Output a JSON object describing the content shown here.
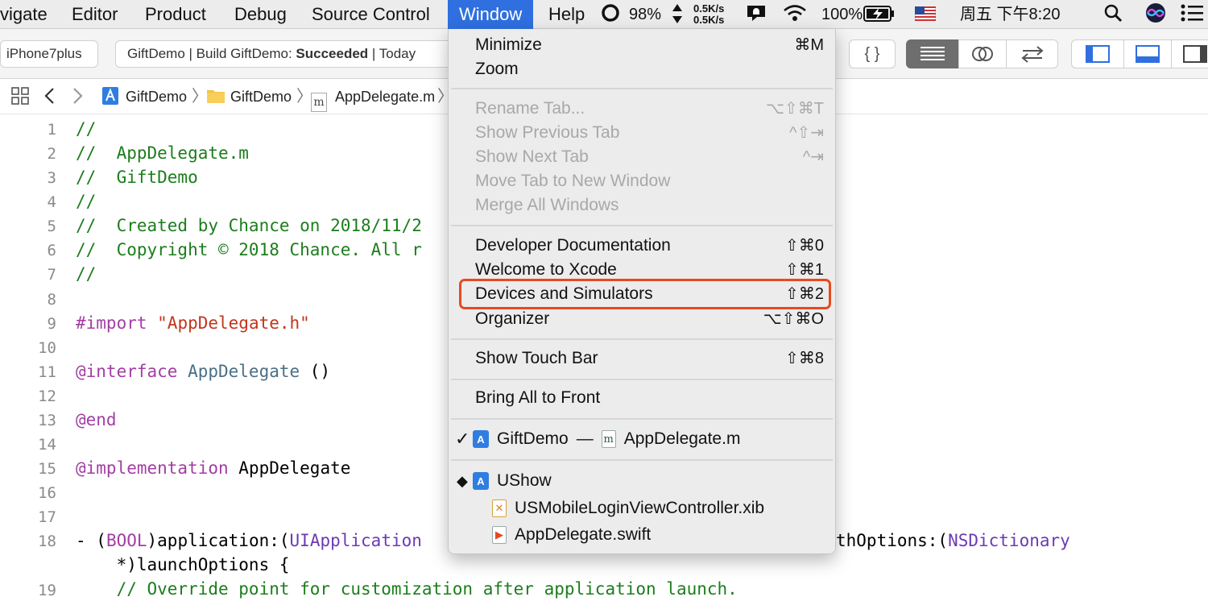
{
  "menubar": {
    "items": [
      "vigate",
      "Editor",
      "Product",
      "Debug",
      "Source Control",
      "Window",
      "Help"
    ],
    "battery_percent": "98%",
    "net_up": "0.5K/s",
    "net_down": "0.5K/s",
    "wifi_battery": "100%",
    "clock": "周五 下午8:20",
    "accent_color": "#2f6fe0"
  },
  "toolbar": {
    "device": "iPhone7plus",
    "status_prefix": "GiftDemo | Build GiftDemo: ",
    "status_result": "Succeeded",
    "status_suffix": " | Today"
  },
  "jumpbar": {
    "crumb1": "GiftDemo",
    "crumb2": "GiftDemo",
    "crumb3": "AppDelegate.m",
    "file_badge": "m"
  },
  "editor": {
    "line_numbers": [
      "1",
      "2",
      "3",
      "4",
      "5",
      "6",
      "7",
      "8",
      "9",
      "10",
      "11",
      "12",
      "13",
      "14",
      "15",
      "16",
      "17",
      "18",
      "",
      "19"
    ],
    "l1": "//",
    "l2": "//  AppDelegate.m",
    "l3": "//  GiftDemo",
    "l4": "//",
    "l5": "//  Created by Chance on 2018/11/2",
    "l6": "//  Copyright © 2018 Chance. All r",
    "l7": "//",
    "l9_kw": "#import ",
    "l9_str": "\"AppDelegate.h\"",
    "l11_kw": "@interface ",
    "l11_type": "AppDelegate",
    "l11_rest": " ()",
    "l13_kw": "@end",
    "l15_kw": "@implementation ",
    "l15_rest": "AppDelegate",
    "l18_a": "- (",
    "l18_bool": "BOOL",
    "l18_b": ")application:(",
    "l18_cls": "UIApplication",
    "l18_right": "thOptions:(",
    "l18_dict": "NSDictionary",
    "l18_cont": "    *)launchOptions {",
    "l19": "    // Override point for customization after application launch."
  },
  "window_menu": {
    "minimize": "Minimize",
    "minimize_sc": "⌘M",
    "zoom": "Zoom",
    "rename_tab": "Rename Tab...",
    "rename_tab_sc": "⌥⇧⌘T",
    "show_prev_tab": "Show Previous Tab",
    "show_prev_tab_sc": "^⇧⇥",
    "show_next_tab": "Show Next Tab",
    "show_next_tab_sc": "^⇥",
    "move_tab": "Move Tab to New Window",
    "merge_all": "Merge All Windows",
    "dev_docs": "Developer Documentation",
    "dev_docs_sc": "⇧⌘0",
    "welcome": "Welcome to Xcode",
    "welcome_sc": "⇧⌘1",
    "devices": "Devices and Simulators",
    "devices_sc": "⇧⌘2",
    "organizer": "Organizer",
    "organizer_sc": "⌥⇧⌘O",
    "touch_bar": "Show Touch Bar",
    "touch_bar_sc": "⇧⌘8",
    "bring_front": "Bring All to Front",
    "current_project": "GiftDemo",
    "current_dash": "—",
    "current_file": "AppDelegate.m",
    "check_mark": "✓",
    "ushow_mark": "◆",
    "ushow": "UShow",
    "ushow_file1": "USMobileLoginViewController.xib",
    "ushow_file2": "AppDelegate.swift",
    "highlight_color": "#e8491f"
  }
}
